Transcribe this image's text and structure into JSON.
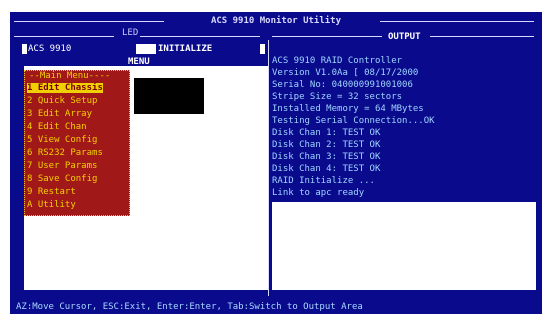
{
  "window": {
    "title": "ACS 9910 Monitor Utility"
  },
  "header": {
    "led_label": "LED",
    "device_name": "ACS 9910",
    "initialize_label": "INITIALIZE",
    "menu_label": "MENU",
    "output_label": "OUTPUT"
  },
  "main_menu": {
    "title": "--Main Menu----",
    "selected_index": 0,
    "items": [
      {
        "label": "1 Edit Chassis"
      },
      {
        "label": "2 Quick Setup"
      },
      {
        "label": "3 Edit Array"
      },
      {
        "label": "4 Edit Chan"
      },
      {
        "label": "5 View Config"
      },
      {
        "label": "6 RS232 Params"
      },
      {
        "label": "7 User Params"
      },
      {
        "label": "8 Save Config"
      },
      {
        "label": "9 Restart"
      },
      {
        "label": "A Utility"
      }
    ]
  },
  "output": {
    "lines": [
      "ACS 9910 RAID Controller",
      "Version V1.0Aa [ 08/17/2000",
      "Serial No: 040000991001006",
      "Stripe Size = 32 sectors",
      "Installed Memory = 64 MBytes",
      "Testing Serial Connection...OK",
      "Disk Chan 1: TEST OK",
      "Disk Chan 2: TEST OK",
      "Disk Chan 3: TEST OK",
      "Disk Chan 4: TEST OK",
      "RAID Initialize ...",
      "Link to apc ready"
    ]
  },
  "status_bar": {
    "text": "AZ:Move Cursor, ESC:Exit, Enter:Enter, Tab:Switch to Output Area"
  },
  "colors": {
    "screen_bg": "#0a0a8c",
    "menu_bg": "#a01818",
    "menu_text": "#f0d000",
    "output_text": "#9fd4ff"
  }
}
